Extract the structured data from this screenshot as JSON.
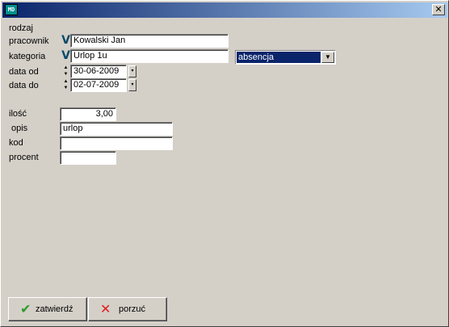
{
  "window": {
    "icon": "app-icon",
    "close_label": "✕"
  },
  "form": {
    "rodzaj_label": "rodzaj",
    "pracownik_label": "pracownik",
    "pracownik_value": "Kowalski Jan",
    "kategoria_label": "kategoria",
    "kategoria_value": "Urlop  1u",
    "kategoria_type": "absencja",
    "data_od_label": "data od",
    "data_od_value": "30-06-2009",
    "data_do_label": "data do",
    "data_do_value": "02-07-2009",
    "ilosc_label": "ilość",
    "ilosc_value": "3,00",
    "opis_label": "opis",
    "opis_value": "urlop",
    "kod_label": "kod",
    "kod_value": "",
    "procent_label": "procent",
    "procent_value": ""
  },
  "buttons": {
    "confirm_label": "zatwierdź",
    "cancel_label": "porzuć"
  },
  "colors": {
    "check": "#2a9d2a",
    "cross": "#e02020",
    "selection": "#0a246a"
  }
}
